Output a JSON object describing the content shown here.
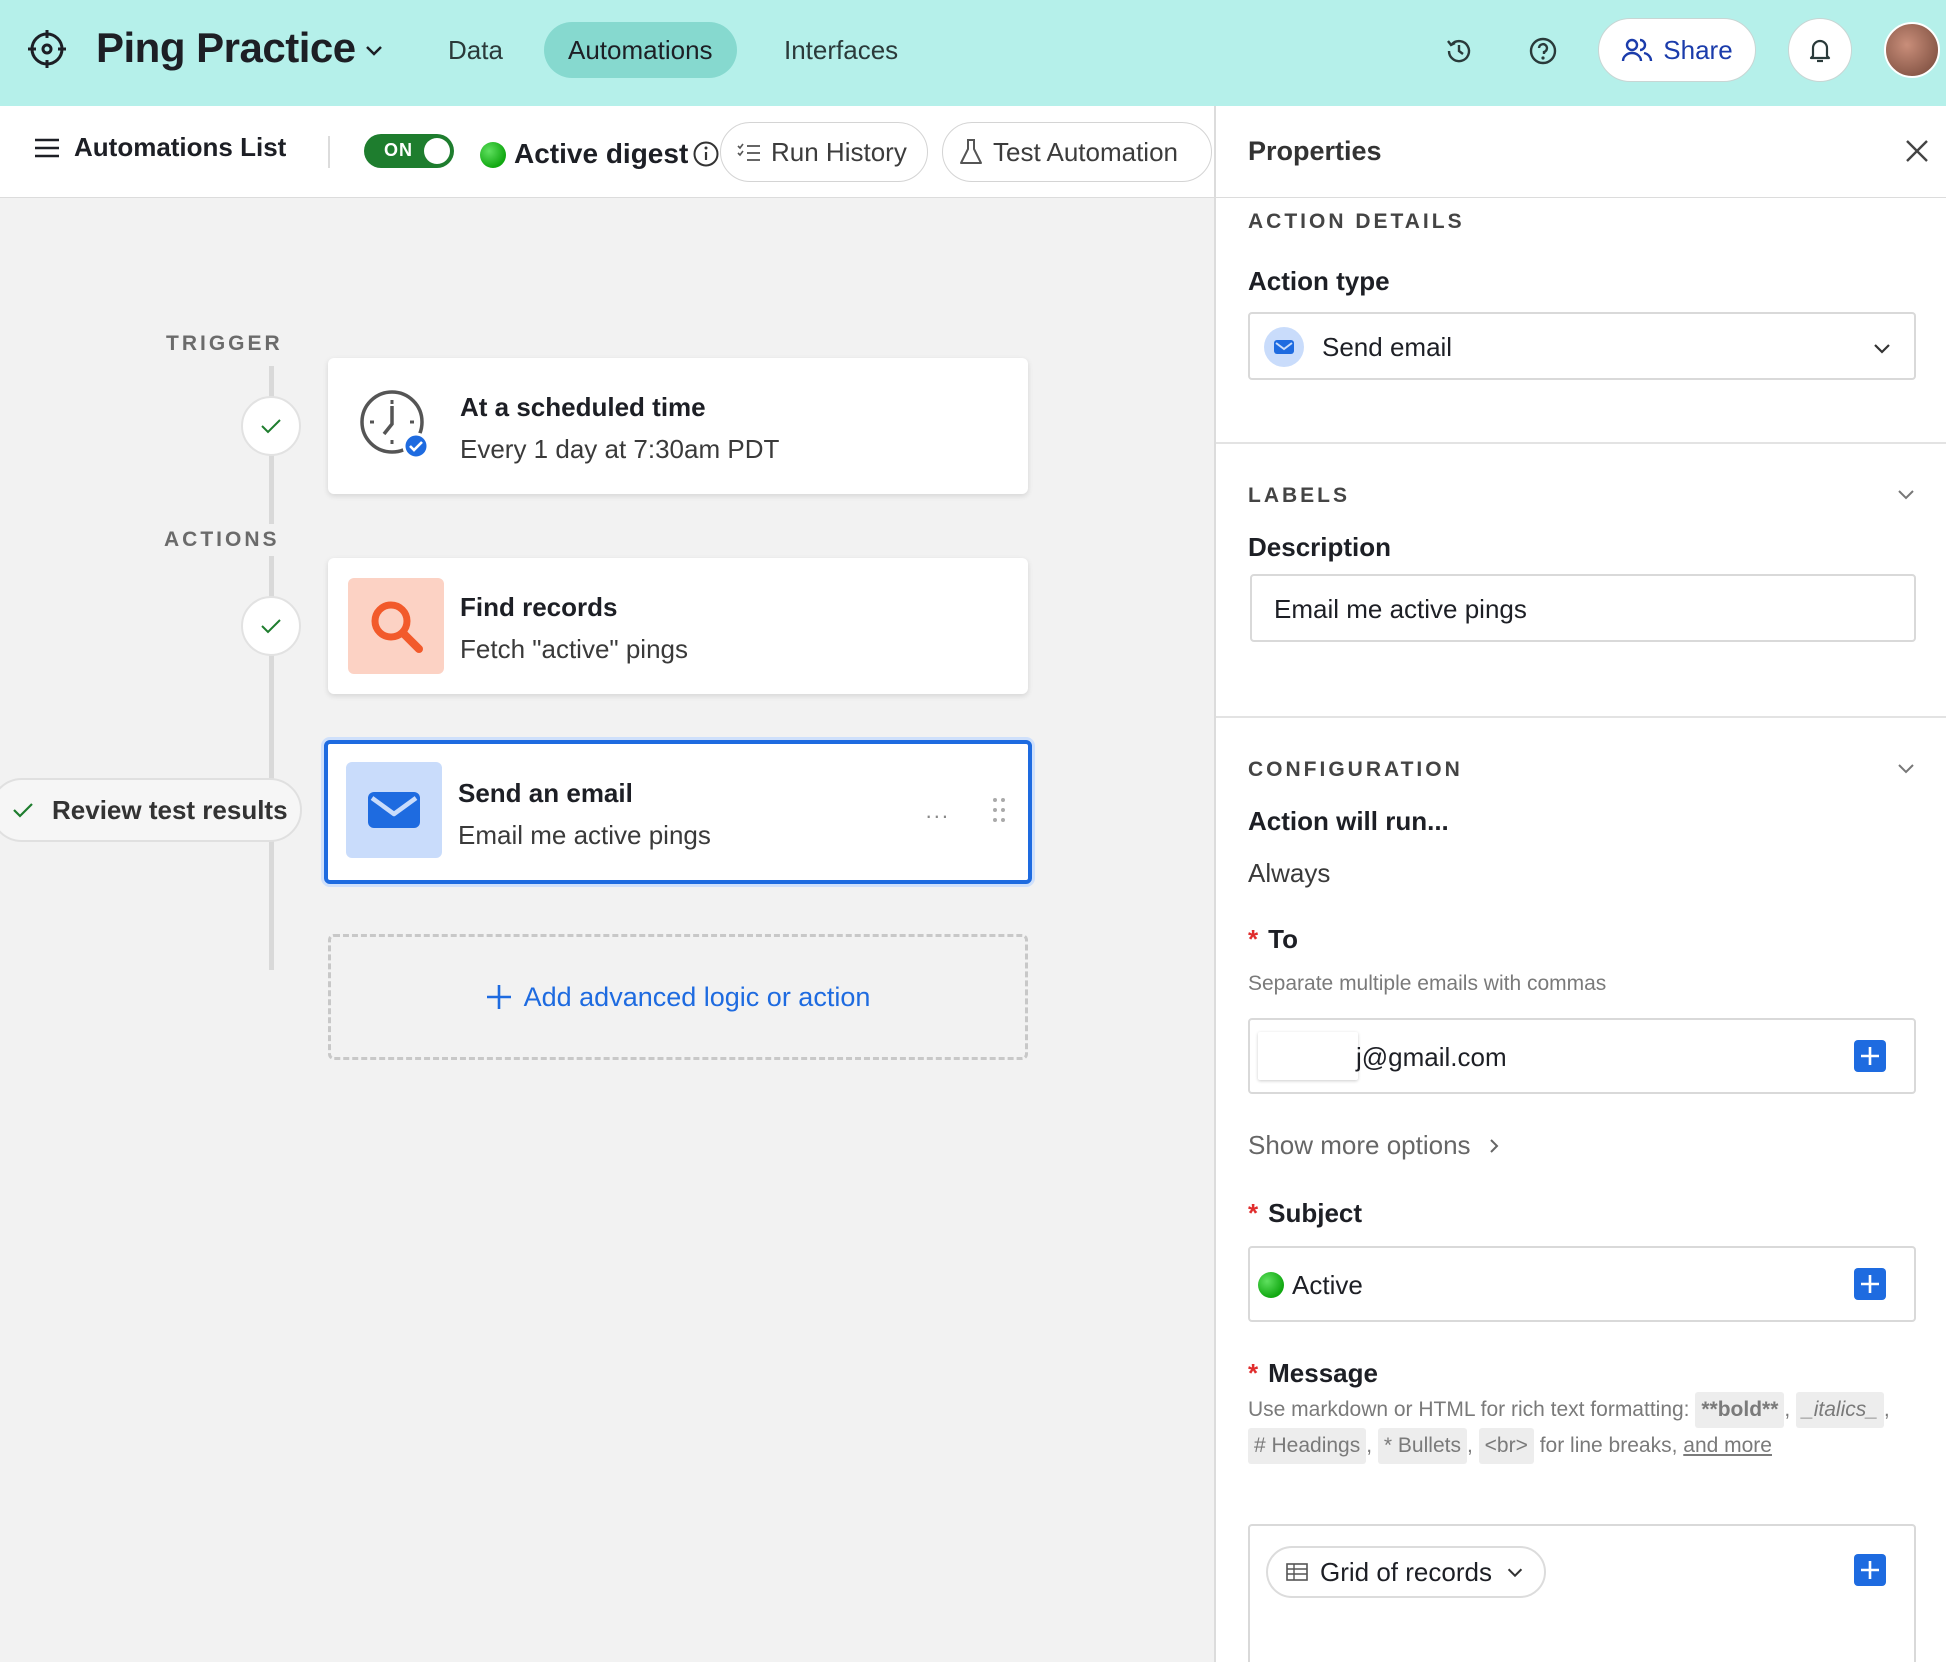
{
  "header": {
    "app_title": "Ping Practice",
    "tabs": [
      {
        "label": "Data"
      },
      {
        "label": "Automations"
      },
      {
        "label": "Interfaces"
      }
    ],
    "active_tab": "Automations",
    "share_label": "Share",
    "icons": [
      "history-icon",
      "help-icon",
      "share-icon",
      "bell-icon"
    ]
  },
  "toolbar": {
    "list_label": "Automations List",
    "toggle_label": "ON",
    "automation_name": "Active digest",
    "run_history_label": "Run History",
    "test_label": "Test Automation"
  },
  "canvas": {
    "trigger_label": "TRIGGER",
    "actions_label": "ACTIONS",
    "trigger_card": {
      "title": "At a scheduled time",
      "subtitle": "Every 1 day at 7:30am PDT"
    },
    "action_cards": [
      {
        "title": "Find records",
        "subtitle": "Fetch \"active\" pings"
      },
      {
        "title": "Send an email",
        "subtitle": "Email me active pings",
        "more": "..."
      }
    ],
    "review_label": "Review test results",
    "add_label": "Add advanced logic or action"
  },
  "properties": {
    "title": "Properties",
    "action_details_title": "ACTION DETAILS",
    "action_type_label": "Action type",
    "action_type_value": "Send email",
    "labels_title": "LABELS",
    "description_label": "Description",
    "description_value": "Email me active pings",
    "configuration_title": "CONFIGURATION",
    "action_will_run_label": "Action will run...",
    "action_will_run_value": "Always",
    "to_label": "To",
    "to_hint": "Separate multiple emails with commas",
    "to_value": "j@gmail.com",
    "show_more_label": "Show more options",
    "subject_label": "Subject",
    "subject_value": "Active",
    "message_label": "Message",
    "message_hint": {
      "prefix": "Use markdown or HTML for rich text formatting:",
      "chips": [
        "**bold**",
        "_italics_",
        "# Headings",
        "* Bullets",
        "<br>"
      ],
      "suffix": "for line breaks,",
      "link": "and more"
    },
    "grid_label": "Grid of records"
  },
  "colors": {
    "topbar_bg": "#b5f0ea",
    "active_tab_bg": "#86d9cf",
    "accent_blue": "#1e6be0",
    "toggle_green": "#1e7d2e",
    "status_green": "#11a811",
    "required_red": "#e02d2d",
    "find_icon_bg": "#fcd2c4",
    "find_icon_fg": "#f25a2b",
    "email_icon_bg": "#c9dcfb"
  }
}
